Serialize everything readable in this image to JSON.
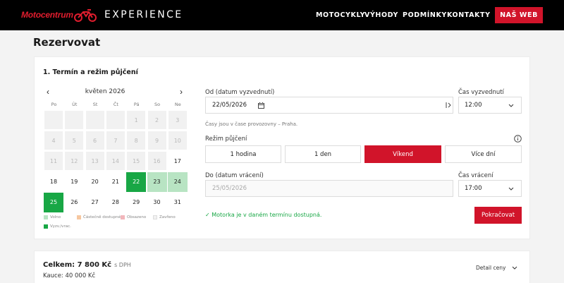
{
  "header": {
    "logo_text": "Motocentrum",
    "brand_sub": "EXPERIENCE",
    "nav": [
      "MOTOCYKLY",
      "VÝHODY",
      "PODMÍNKY",
      "KONTAKTY"
    ],
    "cta": "NAŠ WEB"
  },
  "page_title": "Rezervovat",
  "section": {
    "title": "1. Termín a režim půjčení"
  },
  "calendar": {
    "month": "květen 2026",
    "prev_icon": "‹",
    "next_icon": "›",
    "weekdays": [
      "Po",
      "Út",
      "St",
      "Čt",
      "Pá",
      "So",
      "Ne"
    ],
    "rows": [
      [
        "",
        "",
        "",
        "",
        "1",
        "2",
        "3"
      ],
      [
        "4",
        "5",
        "6",
        "7",
        "8",
        "9",
        "10"
      ],
      [
        "11",
        "12",
        "13",
        "14",
        "15",
        "16",
        "17"
      ],
      [
        "18",
        "19",
        "20",
        "21",
        "22",
        "23",
        "24"
      ],
      [
        "25",
        "26",
        "27",
        "28",
        "29",
        "30",
        "31"
      ]
    ],
    "legend": [
      {
        "label": "Volno",
        "color": "#b8e4c3"
      },
      {
        "label": "Částečně dostupné",
        "color": "#f6c7a0"
      },
      {
        "label": "Obsazeno",
        "color": "#f2b6bb"
      },
      {
        "label": "Zavřeno",
        "color": "#f1f1f1"
      },
      {
        "label": "Vyzv./vrac.",
        "color": "#18a745"
      }
    ]
  },
  "form": {
    "from_label": "Od (datum vyzvednutí)",
    "from_value": "22/05/2026",
    "pickup_time_label": "Čas vyzvednutí",
    "pickup_time_value": "12:00",
    "hint": "Časy jsou v čase provozovny – Praha.",
    "mode_label": "Režim půjčení",
    "modes": [
      "1 hodina",
      "1 den",
      "Víkend",
      "Více dní"
    ],
    "active_mode": "Víkend",
    "to_label": "Do (datum vrácení)",
    "to_value": "25/05/2026",
    "return_time_label": "Čas vrácení",
    "return_time_value": "17:00",
    "availability": "✓ Motorka je v daném termínu dostupná.",
    "continue_button": "Pokračovat"
  },
  "summary": {
    "total_label": "Celkem: 7 800 Kč",
    "total_suffix": "s DPH",
    "deposit": "Kauce: 40 000 Kč",
    "detail_label": "Detail ceny"
  },
  "colors": {
    "brand_red": "#d1142a",
    "available_green": "#18a745",
    "range_green": "#b8e4c3"
  }
}
